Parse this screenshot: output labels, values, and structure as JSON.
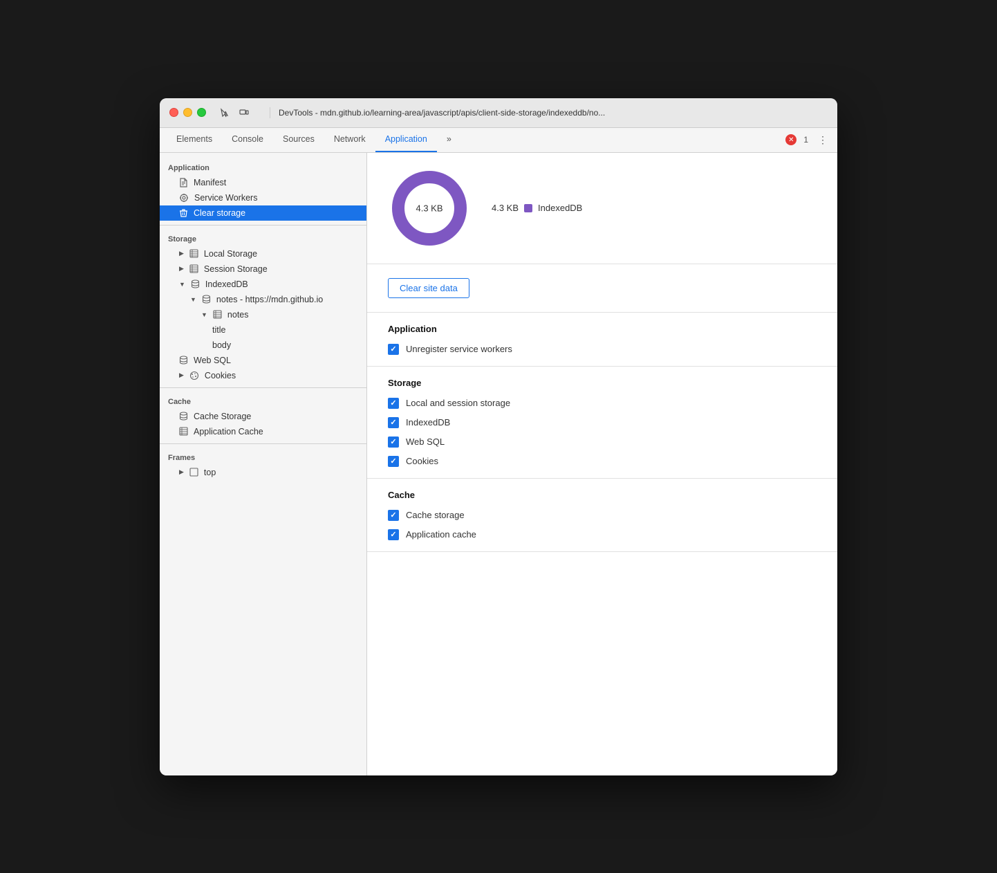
{
  "window": {
    "title": "DevTools - mdn.github.io/learning-area/javascript/apis/client-side-storage/indexeddb/no..."
  },
  "toolbar": {
    "tabs": [
      "Elements",
      "Console",
      "Sources",
      "Network",
      "Application",
      "»"
    ],
    "active_tab": "Application",
    "error_count": "1"
  },
  "sidebar": {
    "application_section": "Application",
    "items_app": [
      {
        "label": "Manifest",
        "icon": "📄",
        "indent": 1
      },
      {
        "label": "Service Workers",
        "icon": "⚙️",
        "indent": 1
      },
      {
        "label": "Clear storage",
        "icon": "🗑",
        "indent": 1,
        "active": true
      }
    ],
    "storage_section": "Storage",
    "items_storage": [
      {
        "label": "Local Storage",
        "icon": "▶",
        "table": true,
        "indent": 1
      },
      {
        "label": "Session Storage",
        "icon": "▶",
        "table": true,
        "indent": 1
      },
      {
        "label": "IndexedDB",
        "icon": "▼",
        "db": true,
        "indent": 1,
        "expanded": true
      },
      {
        "label": "notes - https://mdn.github.io",
        "icon": "▼",
        "db": true,
        "indent": 2,
        "expanded": true
      },
      {
        "label": "notes",
        "icon": "▼",
        "table": true,
        "indent": 3,
        "expanded": true
      },
      {
        "label": "title",
        "indent": 4
      },
      {
        "label": "body",
        "indent": 4
      },
      {
        "label": "Web SQL",
        "icon": "",
        "db": true,
        "indent": 1
      },
      {
        "label": "Cookies",
        "icon": "▶",
        "cookie": true,
        "indent": 1
      }
    ],
    "cache_section": "Cache",
    "items_cache": [
      {
        "label": "Cache Storage",
        "icon": "",
        "db": true,
        "indent": 1
      },
      {
        "label": "Application Cache",
        "icon": "",
        "table": true,
        "indent": 1
      }
    ],
    "frames_section": "Frames",
    "items_frames": [
      {
        "label": "top",
        "icon": "▶",
        "frame": true,
        "indent": 1
      }
    ]
  },
  "donut": {
    "center_label": "4.3 KB",
    "legend": [
      {
        "color": "#7e57c2",
        "size": "4.3 KB",
        "label": "IndexedDB"
      }
    ]
  },
  "clear_button": "Clear site data",
  "settings": {
    "application_title": "Application",
    "application_items": [
      {
        "label": "Unregister service workers",
        "checked": true
      }
    ],
    "storage_title": "Storage",
    "storage_items": [
      {
        "label": "Local and session storage",
        "checked": true
      },
      {
        "label": "IndexedDB",
        "checked": true
      },
      {
        "label": "Web SQL",
        "checked": true
      },
      {
        "label": "Cookies",
        "checked": true
      }
    ],
    "cache_title": "Cache",
    "cache_items": [
      {
        "label": "Cache storage",
        "checked": true
      },
      {
        "label": "Application cache",
        "checked": true
      }
    ]
  }
}
